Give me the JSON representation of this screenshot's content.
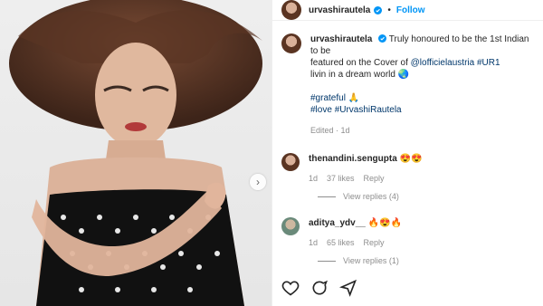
{
  "post": {
    "username": "urvashirautela",
    "follow_label": "Follow",
    "dot": "•"
  },
  "caption": {
    "username": "urvashirautela",
    "text1": "Truly honoured to be the 1st Indian to be",
    "text2": "featured on the Cover of",
    "mention": "@lofficielaustria",
    "tag_ur1": "#UR1",
    "text3": "livin in a dream world",
    "emoji_globe": "🌏",
    "tag_grateful": "#grateful",
    "emoji_pray": "🙏",
    "tag_love": "#love",
    "tag_urvashi": "#UrvashiRautela",
    "meta": "Edited · 1d"
  },
  "comments": [
    {
      "username": "thenandini.sengupta",
      "text": "😍😍",
      "age": "1d",
      "likes": "37 likes",
      "reply": "Reply",
      "view_replies": "View replies (4)"
    },
    {
      "username": "aditya_ydv__",
      "text": "🔥😍🔥",
      "age": "1d",
      "likes": "65 likes",
      "reply": "Reply",
      "view_replies": "View replies (1)"
    }
  ],
  "icons": [
    "heart-icon",
    "comment-icon",
    "share-icon",
    "verified-icon",
    "next-arrow-icon"
  ],
  "colors": {
    "link": "#0095f6",
    "tag": "#00376b",
    "meta": "#8e8e8e"
  }
}
